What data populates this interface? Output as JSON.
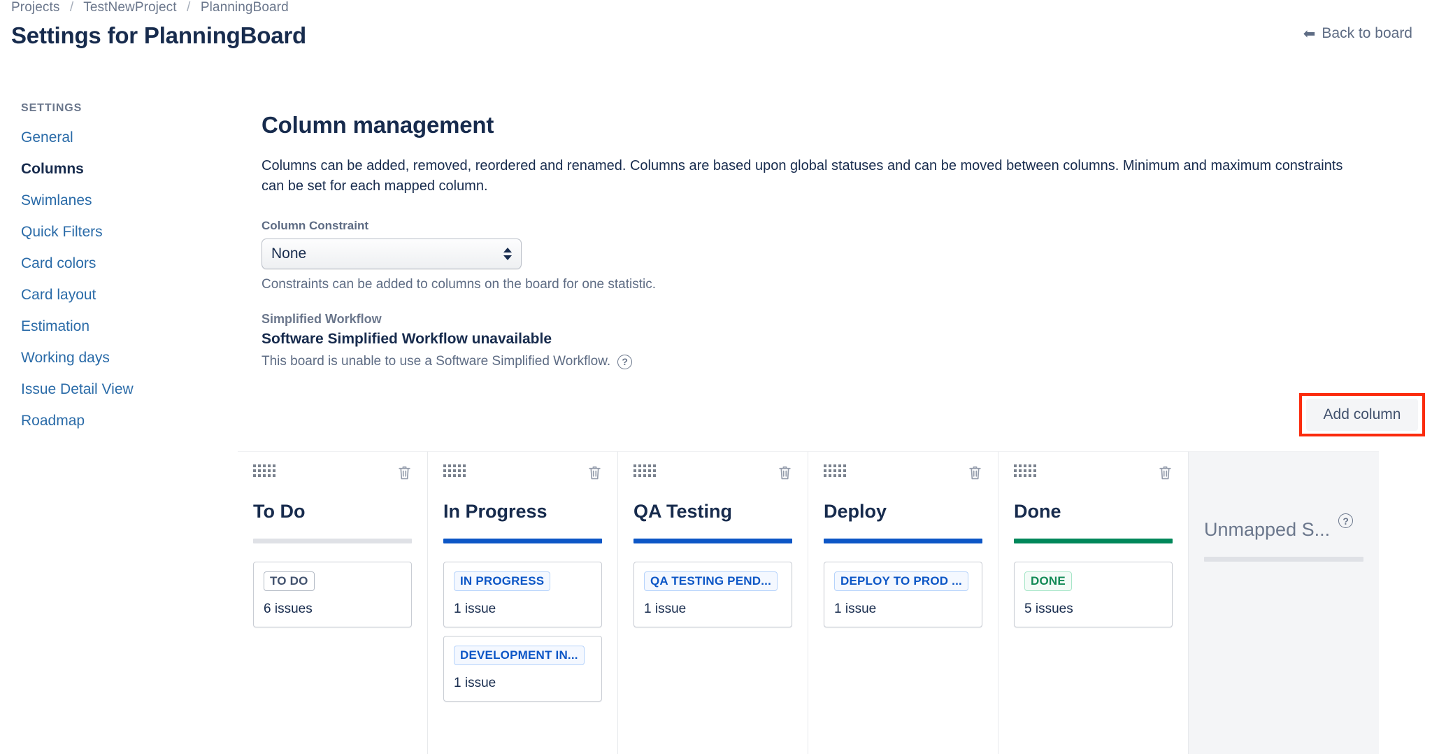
{
  "breadcrumb": {
    "items": [
      "Projects",
      "TestNewProject",
      "PlanningBoard"
    ],
    "separator": "/"
  },
  "header": {
    "title": "Settings for PlanningBoard",
    "back_link": "Back to board",
    "back_icon": "arrow-left-icon"
  },
  "sidebar": {
    "heading": "SETTINGS",
    "items": [
      {
        "label": "General",
        "active": false
      },
      {
        "label": "Columns",
        "active": true
      },
      {
        "label": "Swimlanes",
        "active": false
      },
      {
        "label": "Quick Filters",
        "active": false
      },
      {
        "label": "Card colors",
        "active": false
      },
      {
        "label": "Card layout",
        "active": false
      },
      {
        "label": "Estimation",
        "active": false
      },
      {
        "label": "Working days",
        "active": false
      },
      {
        "label": "Issue Detail View",
        "active": false
      },
      {
        "label": "Roadmap",
        "active": false
      }
    ]
  },
  "main": {
    "section_title": "Column management",
    "section_desc": "Columns can be added, removed, reordered and renamed. Columns are based upon global statuses and can be moved between columns. Minimum and maximum constraints can be set for each mapped column.",
    "constraint": {
      "label": "Column Constraint",
      "value": "None",
      "options": [
        "None"
      ],
      "help": "Constraints can be added to columns on the board for one statistic."
    },
    "workflow": {
      "label": "Simplified Workflow",
      "title": "Software Simplified Workflow unavailable",
      "desc": "This board is unable to use a Software Simplified Workflow.",
      "help_icon": "question-circle-icon"
    },
    "add_column_button": "Add column"
  },
  "colors": {
    "highlight": "#FB2B0D",
    "bar_gray": "#DFE1E6",
    "bar_blue": "#0C56C6",
    "bar_green": "#00875A",
    "link": "#2a6ba8",
    "text": "#172B4D"
  },
  "board": {
    "columns": [
      {
        "name": "To Do",
        "bar_color": "#DFE1E6",
        "unmapped": false,
        "drag_icon": "drag-handle-icon",
        "delete_icon": "trash-icon",
        "statuses": [
          {
            "chip": "TO DO",
            "chip_style": "chip-todo",
            "count": "6 issues"
          }
        ]
      },
      {
        "name": "In Progress",
        "bar_color": "#0C56C6",
        "unmapped": false,
        "drag_icon": "drag-handle-icon",
        "delete_icon": "trash-icon",
        "statuses": [
          {
            "chip": "IN PROGRESS",
            "chip_style": "chip-blue",
            "count": "1 issue"
          },
          {
            "chip": "DEVELOPMENT IN...",
            "chip_style": "chip-blue",
            "count": "1 issue"
          }
        ]
      },
      {
        "name": "QA Testing",
        "bar_color": "#0C56C6",
        "unmapped": false,
        "drag_icon": "drag-handle-icon",
        "delete_icon": "trash-icon",
        "statuses": [
          {
            "chip": "QA TESTING PEND...",
            "chip_style": "chip-blue",
            "count": "1 issue"
          }
        ]
      },
      {
        "name": "Deploy",
        "bar_color": "#0C56C6",
        "unmapped": false,
        "drag_icon": "drag-handle-icon",
        "delete_icon": "trash-icon",
        "statuses": [
          {
            "chip": "DEPLOY TO PROD ...",
            "chip_style": "chip-blue",
            "count": "1 issue"
          }
        ]
      },
      {
        "name": "Done",
        "bar_color": "#00875A",
        "unmapped": false,
        "drag_icon": "drag-handle-icon",
        "delete_icon": "trash-icon",
        "statuses": [
          {
            "chip": "DONE",
            "chip_style": "chip-green",
            "count": "5 issues"
          }
        ]
      },
      {
        "name": "Unmapped S...",
        "bar_color": "#DFE1E6",
        "unmapped": true,
        "help_icon": "question-circle-icon",
        "statuses": []
      }
    ]
  }
}
